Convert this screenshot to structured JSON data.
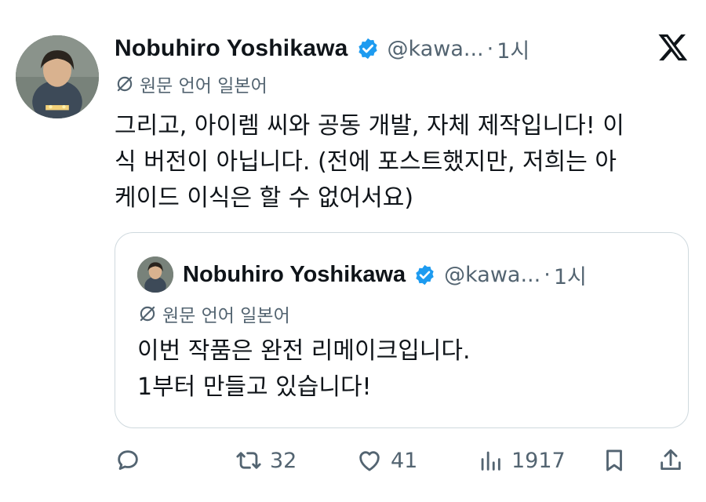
{
  "post": {
    "author_name": "Nobuhiro Yoshikawa",
    "handle": "@kawa...",
    "separator": "·",
    "time": "1시",
    "translated_label": "원문 언어 일본어",
    "body_lines": [
      "그리고, 아이렘 씨와 공동 개발, 자체 제작입니다! 이",
      "식 버전이 아닙니다. (전에 포스트했지만, 저희는 아",
      "케이드 이식은 할 수 없어서요)"
    ]
  },
  "quote": {
    "author_name": "Nobuhiro Yoshikawa",
    "handle": "@kawa...",
    "separator": "·",
    "time": "1시",
    "translated_label": "원문 언어 일본어",
    "body_lines": [
      "이번 작품은 완전 리메이크입니다.",
      "1부터 만들고 있습니다!"
    ]
  },
  "actions": {
    "reply": {
      "icon": "reply-icon",
      "count": ""
    },
    "repost": {
      "icon": "repost-icon",
      "count": "32"
    },
    "like": {
      "icon": "heart-icon",
      "count": "41"
    },
    "views": {
      "icon": "views-icon",
      "count": "1917"
    },
    "bookmark": {
      "icon": "bookmark-icon"
    },
    "share": {
      "icon": "share-icon"
    }
  },
  "colors": {
    "text": "#0f1419",
    "secondary": "#536471",
    "verified": "#1d9bf0",
    "border": "#cfd9de"
  }
}
